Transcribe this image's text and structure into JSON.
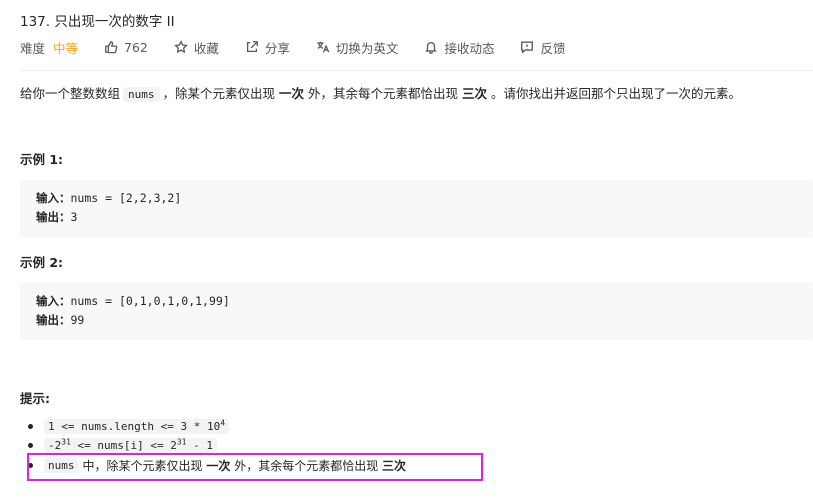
{
  "problem": {
    "title": "137. 只出现一次的数字 II"
  },
  "meta": {
    "difficulty_label": "难度",
    "difficulty_value": "中等",
    "difficulty_color": "#ffa116",
    "likes": "762",
    "favorite_label": "收藏",
    "share_label": "分享",
    "switch_lang_label": "切换为英文",
    "notify_label": "接收动态",
    "feedback_label": "反馈"
  },
  "description": {
    "part1": "给你一个整数数组",
    "code": "nums",
    "part2": "，除某个元素仅出现",
    "bold1": "一次",
    "part3": "外，其余每个元素都恰出现",
    "bold2": "三次",
    "part4": "。请你找出并返回那个只出现了一次的元素。"
  },
  "examples": [
    {
      "title": "示例 1:",
      "input_label": "输入：",
      "input": "nums = [2,2,3,2]",
      "output_label": "输出：",
      "output": "3"
    },
    {
      "title": "示例 2:",
      "input_label": "输入：",
      "input": "nums = [0,1,0,1,0,1,99]",
      "output_label": "输出：",
      "output": "99"
    }
  ],
  "hints": {
    "title": "提示:",
    "h1_code": "1 <= nums.length <= 3 * 10",
    "h1_sup": "4",
    "h2_a": "-2",
    "h2_sup1": "31",
    "h2_b": " <= nums[i] <= 2",
    "h2_sup2": "31",
    "h2_c": " - 1",
    "h3_code": "nums",
    "h3_part1": "中，除某个元素仅出现",
    "h3_bold1": "一次",
    "h3_part2": "外，其余每个元素都恰出现",
    "h3_bold2": "三次"
  },
  "highlight_color": "#e020e0"
}
